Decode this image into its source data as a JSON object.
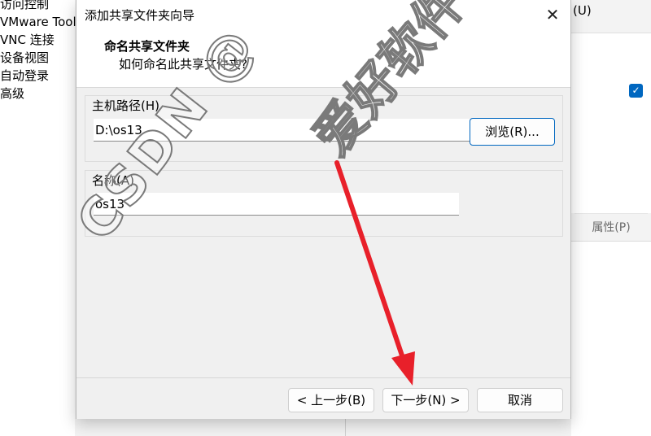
{
  "background": {
    "nav_items": [
      "访问控制",
      "VMware Tools",
      "VNC 连接",
      "设备视图",
      "自动登录",
      "高级"
    ],
    "menu_suffix": "(U)",
    "properties_button": "属性(P)",
    "checkbox_checked": true
  },
  "dialog": {
    "title": "添加共享文件夹向导",
    "header_title": "命名共享文件夹",
    "header_subtitle": "如何命名此共享文件夹?",
    "host_path_label": "主机路径(H)",
    "host_path_value": "D:\\os13",
    "browse_button": "浏览(R)...",
    "name_label": "名称(A)",
    "name_value": "os13",
    "back_button": "< 上一步(B)",
    "next_button": "下一步(N) >",
    "cancel_button": "取消",
    "close_symbol": "✕"
  },
  "watermark": {
    "latin": "CSDN @",
    "cjk": "爱好软件"
  },
  "colors": {
    "accent": "#0067c0",
    "annotation_arrow": "#e8202a"
  }
}
